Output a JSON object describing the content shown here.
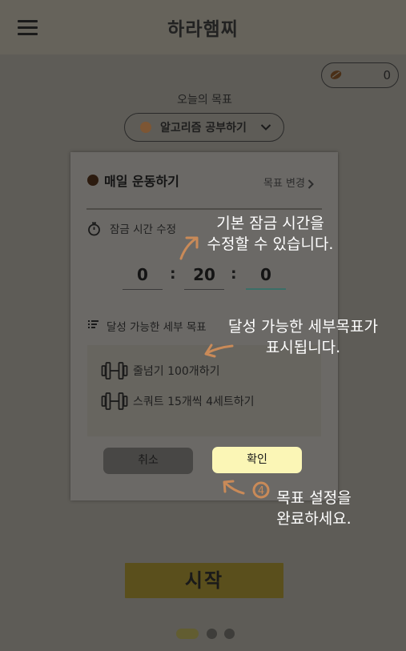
{
  "header": {
    "app_title": "하라햄찌",
    "menu_icon": "hamburger-menu-icon"
  },
  "seed_badge": {
    "icon": "seed-icon",
    "count": "0"
  },
  "main": {
    "today_goal_label": "오늘의 목표",
    "selected_goal": "알고리즘 공부하기",
    "start_button": "시작"
  },
  "modal": {
    "goal_title": "매일 운동하기",
    "change_goal": "목표 변경",
    "lock_time_label": "잠금 시간 수정",
    "time": {
      "hours": "0",
      "minutes": "20",
      "seconds": "0",
      "separator": ":"
    },
    "subgoals_label": "달성 가능한 세부 목표",
    "subgoals": [
      {
        "icon": "dumbbell-icon",
        "text": "줄넘기 100개하기"
      },
      {
        "icon": "dumbbell-icon",
        "text": "스쿼트 15개씩 4세트하기"
      }
    ],
    "cancel": "취소",
    "confirm": "확인"
  },
  "tutorial": {
    "tip_lock_line1": "기본 잠금 시간을",
    "tip_lock_line2": "수정할 수 있습니다.",
    "tip_sub_line1": "달성 가능한 세부목표가",
    "tip_sub_line2": "표시됩니다.",
    "tip_done_line1": "목표 설정을",
    "tip_done_line2": "완료하세요.",
    "step_number": "4"
  },
  "pager": {
    "active_page": 1,
    "total_pages": 3
  },
  "colors": {
    "overlay_bg": "#5e5c57",
    "confirm_button": "#fbf6b6",
    "active_field_underline": "#3b6e67",
    "tutorial_arrow": "#c98a58",
    "start_button": "#5a4f1c"
  }
}
